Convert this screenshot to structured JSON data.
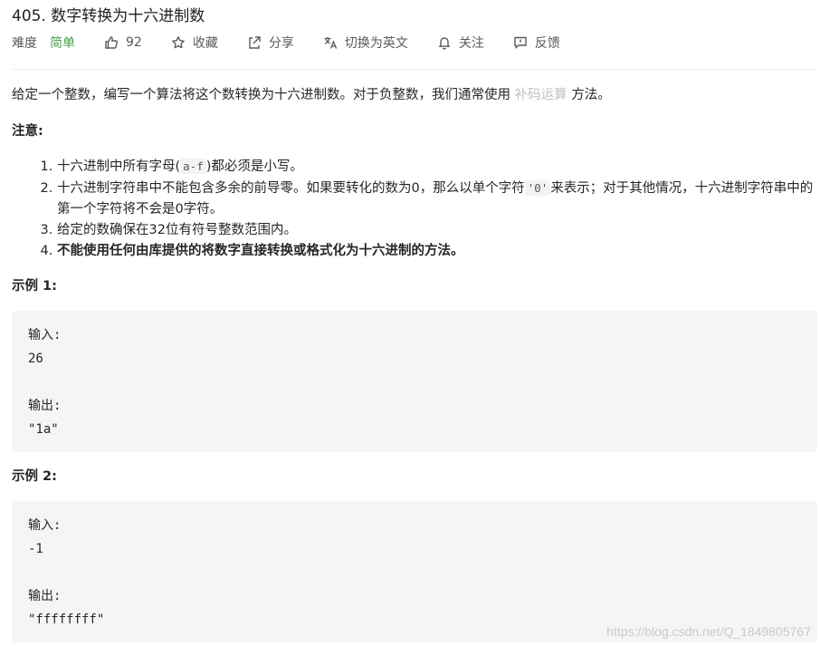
{
  "problem": {
    "title": "405. 数字转换为十六进制数"
  },
  "toolbar": {
    "difficulty_label": "难度",
    "difficulty": "简单",
    "difficulty_color": "#43a047",
    "likes_icon": "thumbs-up-icon",
    "likes": "92",
    "favorite_icon": "star-icon",
    "favorite": "收藏",
    "share_icon": "share-icon",
    "share": "分享",
    "translate_icon": "translate-icon",
    "translate": "切换为英文",
    "follow_icon": "bell-icon",
    "follow": "关注",
    "feedback_icon": "feedback-icon",
    "feedback": "反馈"
  },
  "description": {
    "intro": "给定一个整数，编写一个算法将这个数转换为十六进制数。对于负整数，我们通常使用",
    "intro_link": "补码运算",
    "intro_end": "方法。",
    "note_title": "注意:",
    "notes": [
      {
        "before": "十六进制中所有字母(",
        "code": "a-f",
        "after": ")都必须是小写。"
      },
      {
        "before": "十六进制字符串中不能包含多余的前导零。如果要转化的数为0，那么以单个字符",
        "code": "'0'",
        "after": "来表示；对于其他情况，十六进制字符串中的第一个字符将不会是0字符。"
      },
      {
        "text": "给定的数确保在32位有符号整数范围内。"
      },
      {
        "text": "不能使用任何由库提供的将数字直接转换或格式化为十六进制的方法。"
      }
    ]
  },
  "examples": [
    {
      "title": "示例 1:",
      "input_label": "输入:",
      "input": "26",
      "output_label": "输出:",
      "output": "\"1a\""
    },
    {
      "title": "示例 2:",
      "input_label": "输入:",
      "input": "-1",
      "output_label": "输出:",
      "output": "\"ffffffff\""
    }
  ],
  "watermark": "https://blog.csdn.net/Q_1849805767"
}
